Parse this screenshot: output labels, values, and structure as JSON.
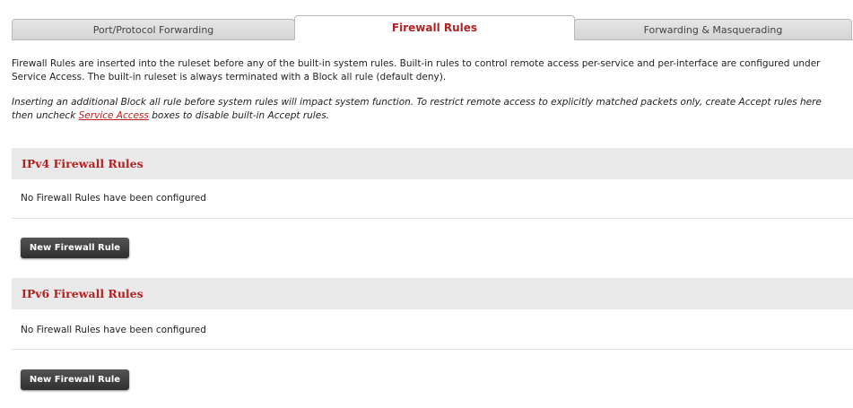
{
  "tabs": [
    {
      "label": "Port/Protocol Forwarding",
      "active": false
    },
    {
      "label": "Firewall Rules",
      "active": true
    },
    {
      "label": "Forwarding & Masquerading",
      "active": false
    }
  ],
  "description": "Firewall Rules are inserted into the ruleset before any of the built-in system rules. Built-in rules to control remote access per-service and per-interface are configured under Service Access. The built-in ruleset is always terminated with a Block all rule (default deny).",
  "warning": {
    "before": "Inserting an additional Block all rule before system rules will impact system function. To restrict remote access to explicitly matched packets only, create Accept rules here then uncheck ",
    "link": "Service Access",
    "after": " boxes to disable built-in Accept rules."
  },
  "ipv4": {
    "title": "IPv4 Firewall Rules",
    "empty_text": "No Firewall Rules have been configured",
    "button_label": "New Firewall Rule"
  },
  "ipv6": {
    "title": "IPv6 Firewall Rules",
    "empty_text": "No Firewall Rules have been configured",
    "button_label": "New Firewall Rule"
  },
  "colors": {
    "accent": "#b22222",
    "link": "#c01d1d",
    "section_bg": "#e9e9e9",
    "button_bg": "#3a3a3a"
  }
}
